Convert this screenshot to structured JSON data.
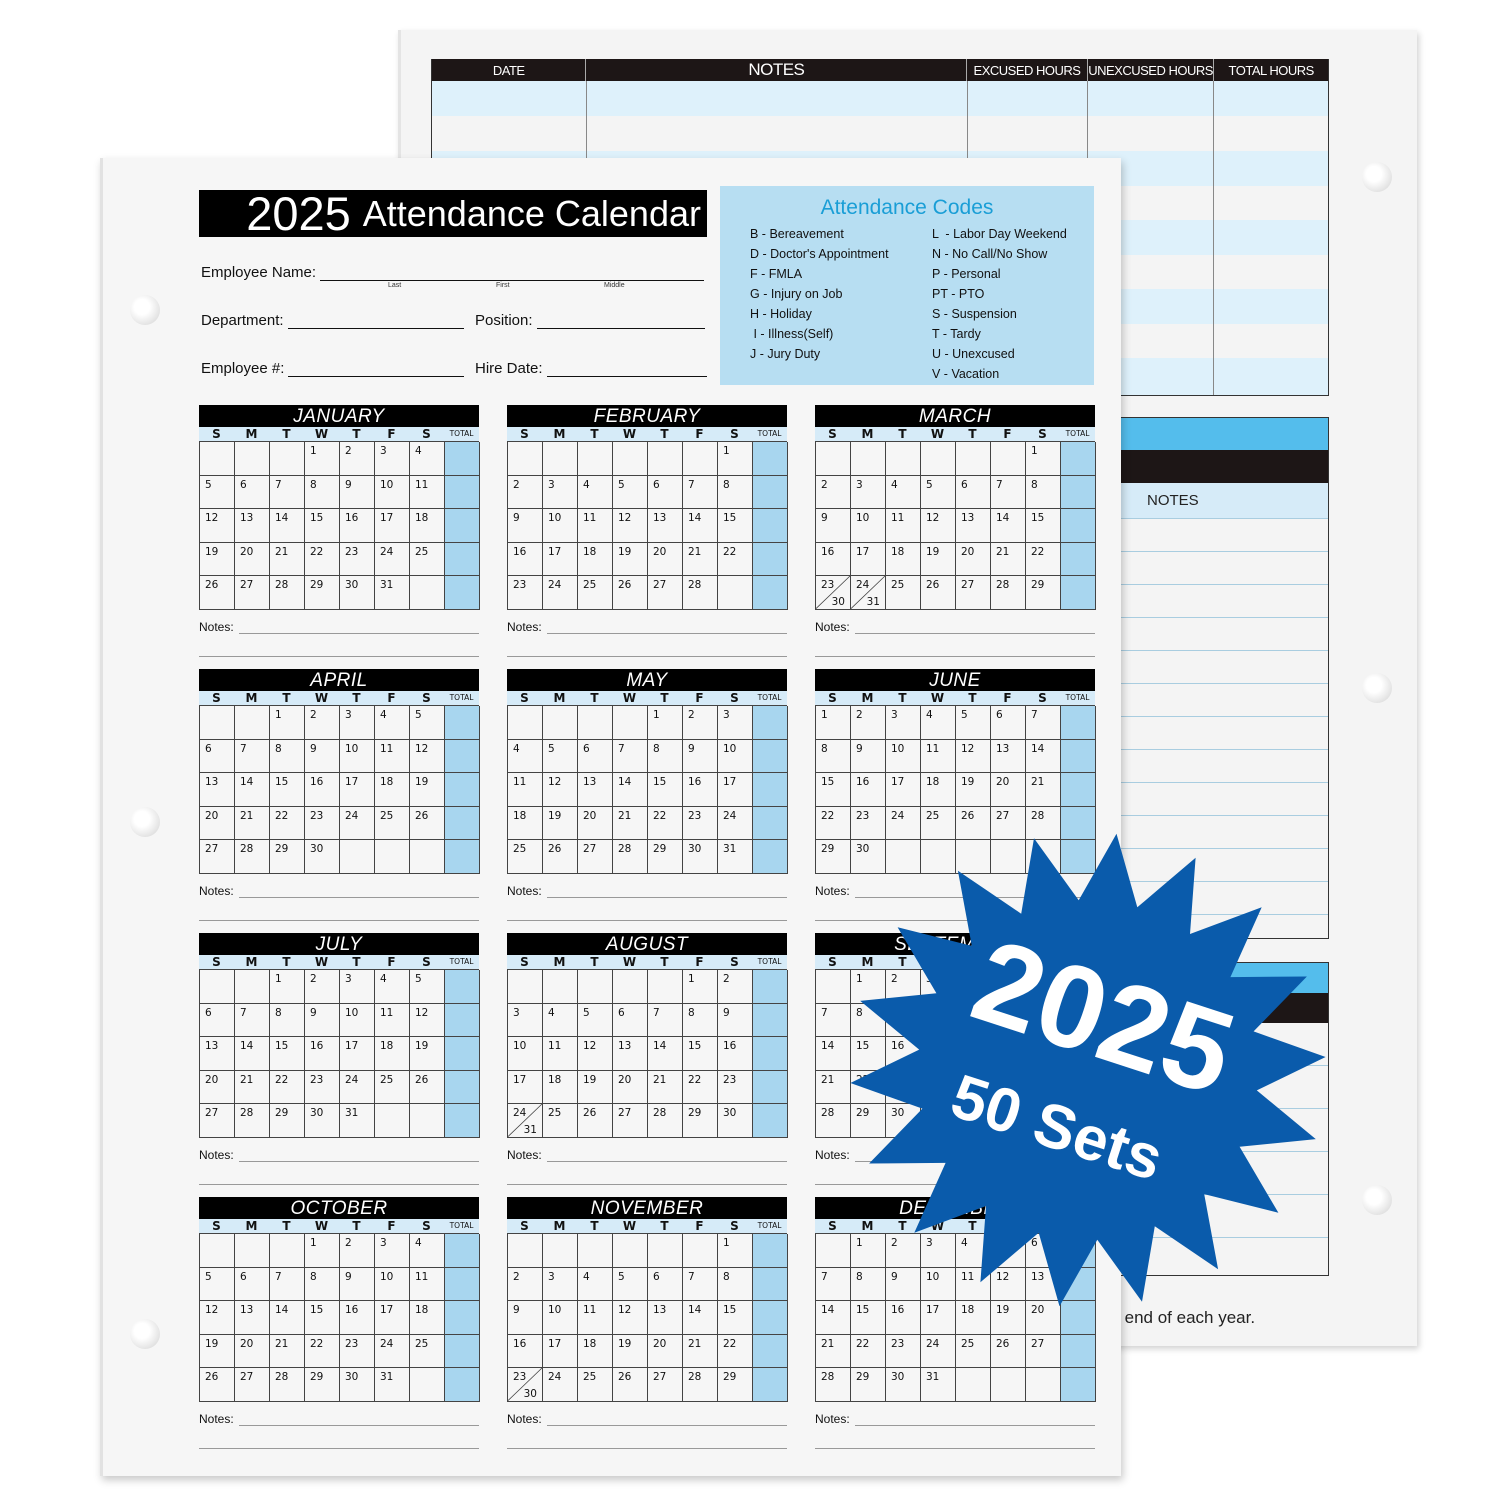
{
  "back_sheet": {
    "table_headers": [
      "DATE",
      "NOTES",
      "EXCUSED HOURS",
      "UNEXCUSED HOURS",
      "TOTAL HOURS"
    ],
    "notes_header": "NOTES",
    "footnote": "he end of each year."
  },
  "front_sheet": {
    "title_year": "2025",
    "title_text": "Attendance Calendar",
    "fields": {
      "employee_name": "Employee Name:",
      "name_sublabels": [
        "Last",
        "First",
        "Middle"
      ],
      "department": "Department:",
      "position": "Position:",
      "employee_number": "Employee #:",
      "hire_date": "Hire Date:"
    },
    "codes": {
      "title": "Attendance Codes",
      "left": [
        "B - Bereavement",
        "D - Doctor's Appointment",
        "F - FMLA",
        "G - Injury on Job",
        "H - Holiday",
        " I - Illness(Self)",
        "J - Jury Duty"
      ],
      "right": [
        "L  - Labor Day Weekend",
        "N - No Call/No Show",
        "P - Personal",
        "PT - PTO",
        "S - Suspension",
        "T - Tardy",
        "U - Unexcused",
        "V - Vacation"
      ]
    },
    "weekday_headers": [
      "S",
      "M",
      "T",
      "W",
      "T",
      "F",
      "S"
    ],
    "total_label": "TOTAL",
    "notes_label": "Notes:",
    "months": [
      {
        "name": "JANUARY",
        "start": 3,
        "days": 31
      },
      {
        "name": "FEBRUARY",
        "start": 6,
        "days": 28
      },
      {
        "name": "MARCH",
        "start": 6,
        "days": 31
      },
      {
        "name": "APRIL",
        "start": 2,
        "days": 30
      },
      {
        "name": "MAY",
        "start": 4,
        "days": 31
      },
      {
        "name": "JUNE",
        "start": 0,
        "days": 30
      },
      {
        "name": "JULY",
        "start": 2,
        "days": 31
      },
      {
        "name": "AUGUST",
        "start": 5,
        "days": 31
      },
      {
        "name": "SEPTEMBER",
        "start": 1,
        "days": 30
      },
      {
        "name": "OCTOBER",
        "start": 3,
        "days": 31
      },
      {
        "name": "NOVEMBER",
        "start": 6,
        "days": 30
      },
      {
        "name": "DECEMBER",
        "start": 1,
        "days": 31
      }
    ]
  },
  "badge": {
    "year": "2025",
    "subtitle": "50 Sets",
    "color": "#0a5bab"
  },
  "colors": {
    "total_column": "#a8d6ef",
    "codes_box": "#b7def2",
    "codes_title": "#1a9ed6"
  }
}
